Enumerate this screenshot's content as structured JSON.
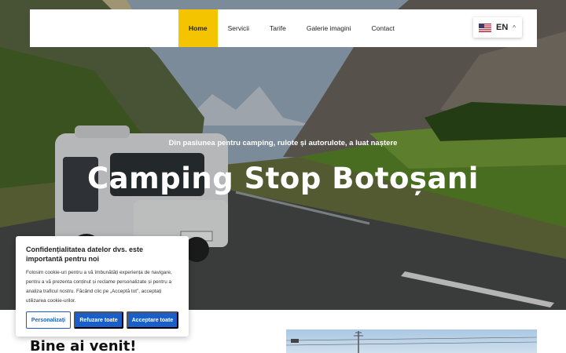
{
  "nav": {
    "items": [
      {
        "label": "Home",
        "active": true
      },
      {
        "label": "Servicii"
      },
      {
        "label": "Tarife"
      },
      {
        "label": "Galerie imagini"
      },
      {
        "label": "Contact"
      }
    ],
    "language": {
      "code": "EN",
      "flag_icon": "us-flag-icon",
      "caret_icon": "chevron-up-icon"
    },
    "active_color": "#f5c400"
  },
  "hero": {
    "tagline": "Din pasiunea pentru camping, rulote și autorulote, a luat naștere",
    "title": "Camping Stop Botoșani"
  },
  "content": {
    "welcome": "Bine ai venit!"
  },
  "cookie_banner": {
    "title": "Confidențialitatea datelor dvs. este importantă pentru noi",
    "text": "Folosim cookie-uri pentru a vă îmbunătăți experiența de navigare, pentru a vă prezenta conținut și reclame personalizate și pentru a analiza traficul nostru. Făcând clic pe „Acceptă tot”, acceptați utilizarea cookie-urilor.",
    "buttons": {
      "customize": "Personalizați",
      "reject": "Refuzare toate",
      "accept": "Acceptare toate"
    },
    "accent_color": "#1a5fc8"
  }
}
